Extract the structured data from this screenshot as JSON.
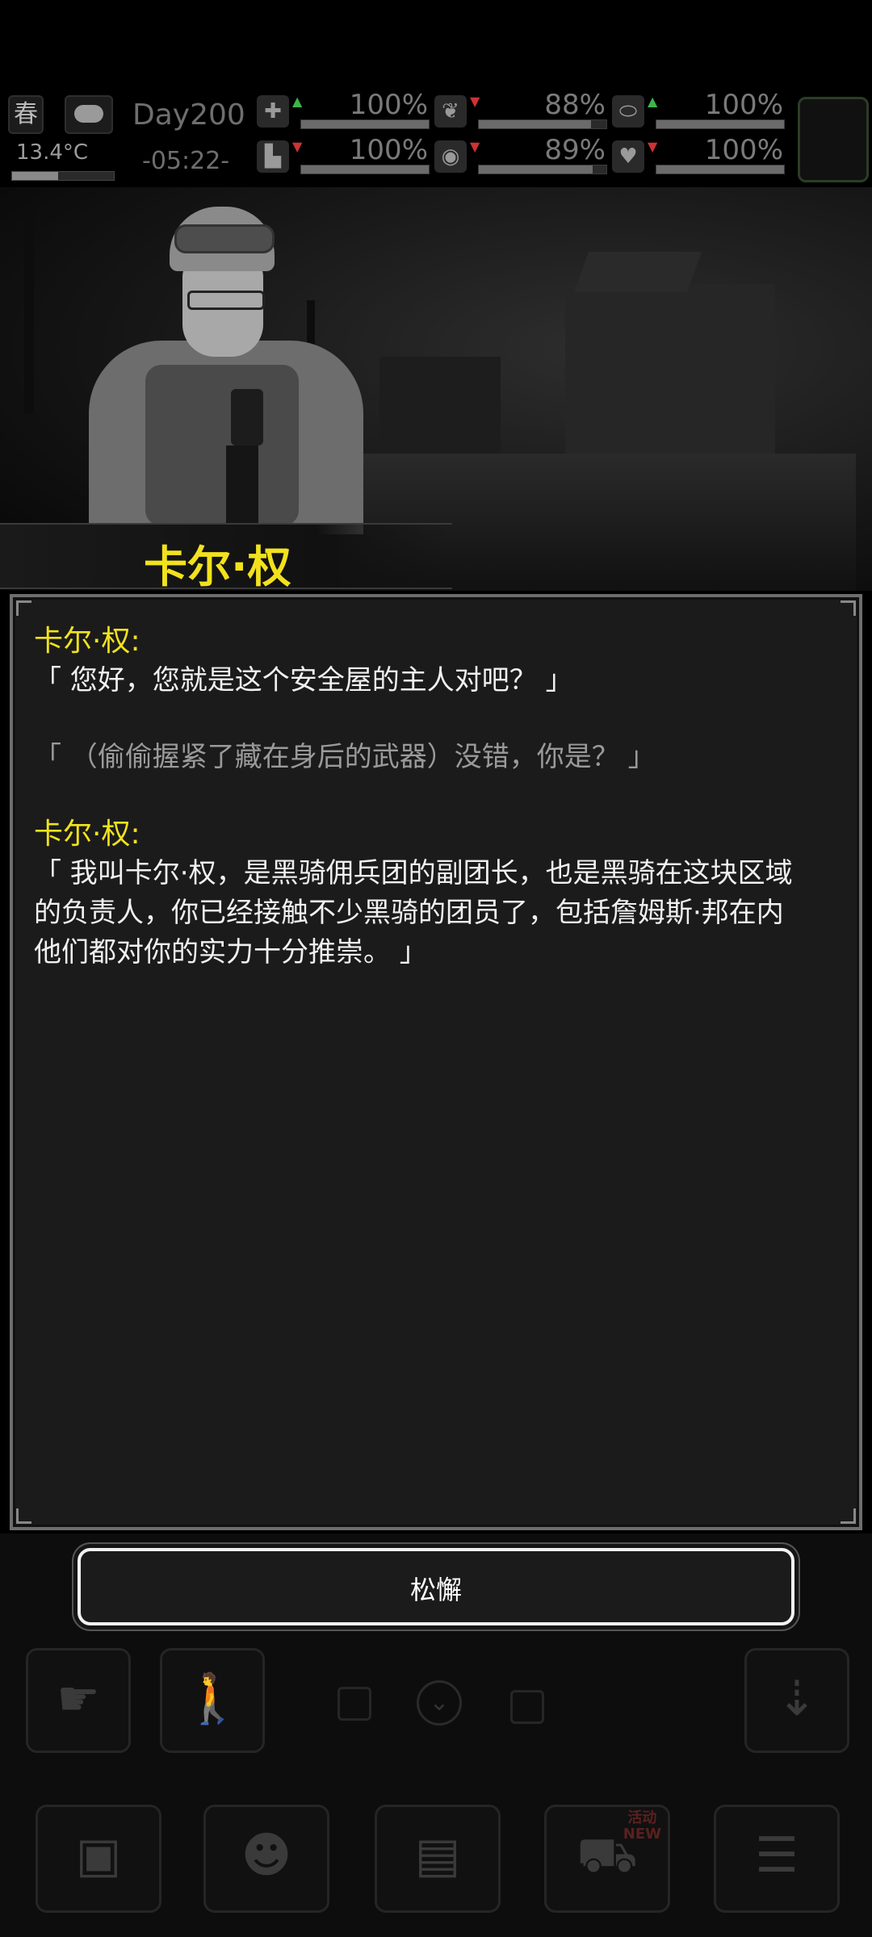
{
  "hud": {
    "season": "春",
    "temperature": "13.4°C",
    "day": "Day200",
    "time": "-05:22-",
    "stats": [
      {
        "icon": "medkit-icon",
        "value": "100%",
        "trend": "up",
        "level": 100
      },
      {
        "icon": "stomach-icon",
        "value": "88%",
        "trend": "down",
        "level": 88
      },
      {
        "icon": "pill-icon",
        "value": "100%",
        "trend": "up",
        "level": 100
      },
      {
        "icon": "boot-icon",
        "value": "100%",
        "trend": "down",
        "level": 100
      },
      {
        "icon": "water-drop-icon",
        "value": "89%",
        "trend": "down",
        "level": 89
      },
      {
        "icon": "heart-icon",
        "value": "100%",
        "trend": "down",
        "level": 100
      }
    ]
  },
  "character": {
    "name": "卡尔·权"
  },
  "dialog": {
    "speaker1": "卡尔·权:",
    "line1": "「 您好，您就是这个安全屋的主人对吧？ 」",
    "reply1": "「 （偷偷握紧了藏在身后的武器）没错，你是？ 」",
    "speaker2": "卡尔·权:",
    "line2a": "「 我叫卡尔·权，是黑骑佣兵团的副团长，也是黑骑在这块区域",
    "line2b": "的负责人，你已经接触不少黑骑的团员了，包括詹姆斯·邦在内",
    "line2c": "他们都对你的实力十分推崇。 」"
  },
  "action": {
    "button_label": "松懈"
  },
  "bottom_badge": {
    "line1": "活动",
    "line2": "NEW"
  },
  "colors": {
    "name_yellow": "#f2e21c",
    "dialog_bg": "#1b1b1b",
    "trend_up": "#3fb44c",
    "trend_down": "#cc3333"
  }
}
